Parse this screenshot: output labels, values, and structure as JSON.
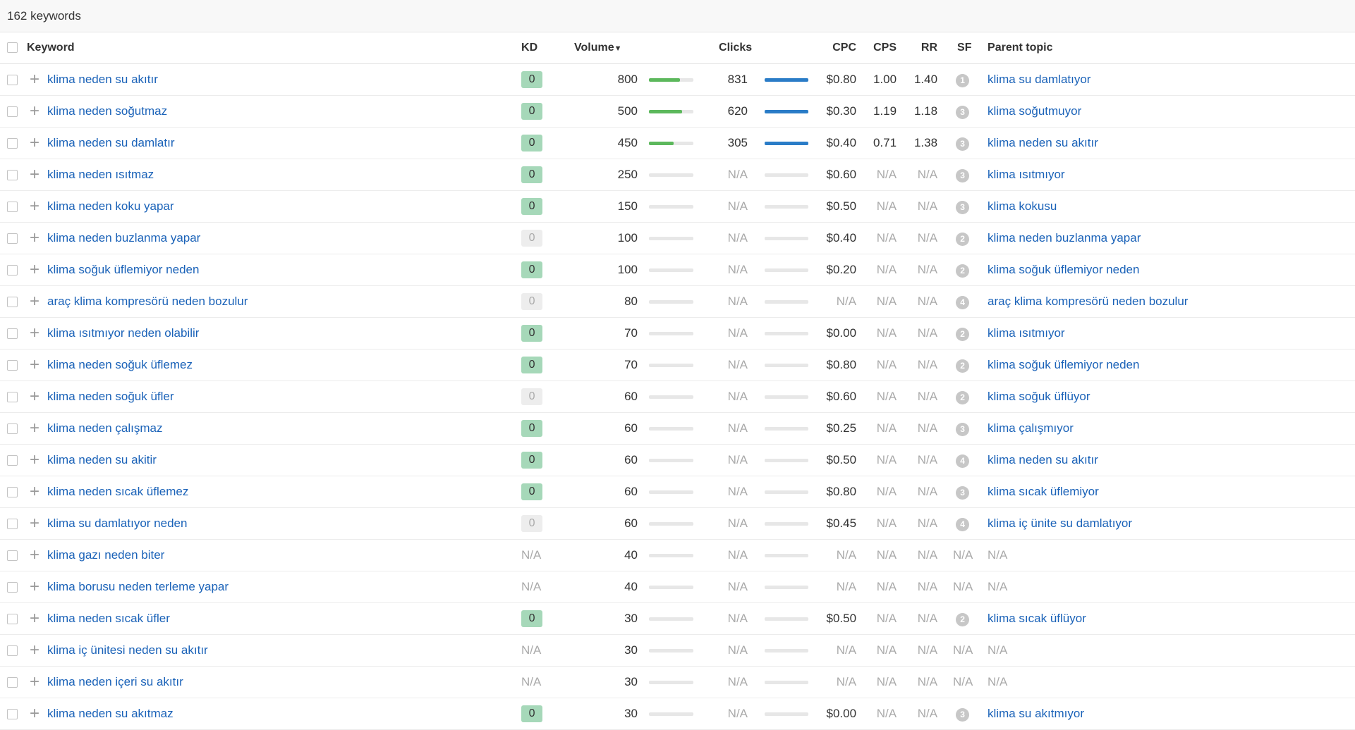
{
  "header": {
    "count_label": "162 keywords"
  },
  "columns": {
    "keyword": "Keyword",
    "kd": "KD",
    "volume": "Volume",
    "volume_sort": "▼",
    "clicks": "Clicks",
    "cpc": "CPC",
    "cps": "CPS",
    "rr": "RR",
    "sf": "SF",
    "parent_topic": "Parent topic"
  },
  "colors": {
    "link": "#1a62b8",
    "kd_green": "#a6d8b9",
    "volume_bar": "#5cb85c",
    "clicks_bar": "#2a7cc7"
  },
  "rows": [
    {
      "keyword": "klima neden su akıtır",
      "kd": "0",
      "kd_style": "green",
      "volume": "800",
      "volume_fill": 0.7,
      "clicks": "831",
      "clicks_fill": 1,
      "cpc": "$0.80",
      "cps": "1.00",
      "rr": "1.40",
      "sf": "1",
      "parent_topic": "klima su damlatıyor"
    },
    {
      "keyword": "klima neden soğutmaz",
      "kd": "0",
      "kd_style": "green",
      "volume": "500",
      "volume_fill": 0.75,
      "clicks": "620",
      "clicks_fill": 1,
      "cpc": "$0.30",
      "cps": "1.19",
      "rr": "1.18",
      "sf": "3",
      "parent_topic": "klima soğutmuyor"
    },
    {
      "keyword": "klima neden su damlatır",
      "kd": "0",
      "kd_style": "green",
      "volume": "450",
      "volume_fill": 0.55,
      "clicks": "305",
      "clicks_fill": 1,
      "cpc": "$0.40",
      "cps": "0.71",
      "rr": "1.38",
      "sf": "3",
      "parent_topic": "klima neden su akıtır"
    },
    {
      "keyword": "klima neden ısıtmaz",
      "kd": "0",
      "kd_style": "green",
      "volume": "250",
      "volume_fill": 0,
      "clicks": "N/A",
      "clicks_fill": 0,
      "cpc": "$0.60",
      "cps": "N/A",
      "rr": "N/A",
      "sf": "3",
      "parent_topic": "klima ısıtmıyor"
    },
    {
      "keyword": "klima neden koku yapar",
      "kd": "0",
      "kd_style": "green",
      "volume": "150",
      "volume_fill": 0,
      "clicks": "N/A",
      "clicks_fill": 0,
      "cpc": "$0.50",
      "cps": "N/A",
      "rr": "N/A",
      "sf": "3",
      "parent_topic": "klima kokusu"
    },
    {
      "keyword": "klima neden buzlanma yapar",
      "kd": "0",
      "kd_style": "grey",
      "volume": "100",
      "volume_fill": 0,
      "clicks": "N/A",
      "clicks_fill": 0,
      "cpc": "$0.40",
      "cps": "N/A",
      "rr": "N/A",
      "sf": "2",
      "parent_topic": "klima neden buzlanma yapar"
    },
    {
      "keyword": "klima soğuk üflemiyor neden",
      "kd": "0",
      "kd_style": "green",
      "volume": "100",
      "volume_fill": 0,
      "clicks": "N/A",
      "clicks_fill": 0,
      "cpc": "$0.20",
      "cps": "N/A",
      "rr": "N/A",
      "sf": "2",
      "parent_topic": "klima soğuk üflemiyor neden"
    },
    {
      "keyword": "araç klima kompresörü neden bozulur",
      "kd": "0",
      "kd_style": "grey",
      "volume": "80",
      "volume_fill": 0,
      "clicks": "N/A",
      "clicks_fill": 0,
      "cpc": "N/A",
      "cps": "N/A",
      "rr": "N/A",
      "sf": "4",
      "parent_topic": "araç klima kompresörü neden bozulur"
    },
    {
      "keyword": "klima ısıtmıyor neden olabilir",
      "kd": "0",
      "kd_style": "green",
      "volume": "70",
      "volume_fill": 0,
      "clicks": "N/A",
      "clicks_fill": 0,
      "cpc": "$0.00",
      "cps": "N/A",
      "rr": "N/A",
      "sf": "2",
      "parent_topic": "klima ısıtmıyor"
    },
    {
      "keyword": "klima neden soğuk üflemez",
      "kd": "0",
      "kd_style": "green",
      "volume": "70",
      "volume_fill": 0,
      "clicks": "N/A",
      "clicks_fill": 0,
      "cpc": "$0.80",
      "cps": "N/A",
      "rr": "N/A",
      "sf": "2",
      "parent_topic": "klima soğuk üflemiyor neden"
    },
    {
      "keyword": "klima neden soğuk üfler",
      "kd": "0",
      "kd_style": "grey",
      "volume": "60",
      "volume_fill": 0,
      "clicks": "N/A",
      "clicks_fill": 0,
      "cpc": "$0.60",
      "cps": "N/A",
      "rr": "N/A",
      "sf": "2",
      "parent_topic": "klima soğuk üflüyor"
    },
    {
      "keyword": "klima neden çalışmaz",
      "kd": "0",
      "kd_style": "green",
      "volume": "60",
      "volume_fill": 0,
      "clicks": "N/A",
      "clicks_fill": 0,
      "cpc": "$0.25",
      "cps": "N/A",
      "rr": "N/A",
      "sf": "3",
      "parent_topic": "klima çalışmıyor"
    },
    {
      "keyword": "klima neden su akitir",
      "kd": "0",
      "kd_style": "green",
      "volume": "60",
      "volume_fill": 0,
      "clicks": "N/A",
      "clicks_fill": 0,
      "cpc": "$0.50",
      "cps": "N/A",
      "rr": "N/A",
      "sf": "4",
      "parent_topic": "klima neden su akıtır"
    },
    {
      "keyword": "klima neden sıcak üflemez",
      "kd": "0",
      "kd_style": "green",
      "volume": "60",
      "volume_fill": 0,
      "clicks": "N/A",
      "clicks_fill": 0,
      "cpc": "$0.80",
      "cps": "N/A",
      "rr": "N/A",
      "sf": "3",
      "parent_topic": "klima sıcak üflemiyor"
    },
    {
      "keyword": "klima su damlatıyor neden",
      "kd": "0",
      "kd_style": "grey",
      "volume": "60",
      "volume_fill": 0,
      "clicks": "N/A",
      "clicks_fill": 0,
      "cpc": "$0.45",
      "cps": "N/A",
      "rr": "N/A",
      "sf": "4",
      "parent_topic": "klima iç ünite su damlatıyor"
    },
    {
      "keyword": "klima gazı neden biter",
      "kd": "N/A",
      "kd_style": "na",
      "volume": "40",
      "volume_fill": 0,
      "clicks": "N/A",
      "clicks_fill": 0,
      "cpc": "N/A",
      "cps": "N/A",
      "rr": "N/A",
      "sf": "N/A",
      "parent_topic": "N/A"
    },
    {
      "keyword": "klima borusu neden terleme yapar",
      "kd": "N/A",
      "kd_style": "na",
      "volume": "40",
      "volume_fill": 0,
      "clicks": "N/A",
      "clicks_fill": 0,
      "cpc": "N/A",
      "cps": "N/A",
      "rr": "N/A",
      "sf": "N/A",
      "parent_topic": "N/A"
    },
    {
      "keyword": "klima neden sıcak üfler",
      "kd": "0",
      "kd_style": "green",
      "volume": "30",
      "volume_fill": 0,
      "clicks": "N/A",
      "clicks_fill": 0,
      "cpc": "$0.50",
      "cps": "N/A",
      "rr": "N/A",
      "sf": "2",
      "parent_topic": "klima sıcak üflüyor"
    },
    {
      "keyword": "klima iç ünitesi neden su akıtır",
      "kd": "N/A",
      "kd_style": "na",
      "volume": "30",
      "volume_fill": 0,
      "clicks": "N/A",
      "clicks_fill": 0,
      "cpc": "N/A",
      "cps": "N/A",
      "rr": "N/A",
      "sf": "N/A",
      "parent_topic": "N/A"
    },
    {
      "keyword": "klima neden içeri su akıtır",
      "kd": "N/A",
      "kd_style": "na",
      "volume": "30",
      "volume_fill": 0,
      "clicks": "N/A",
      "clicks_fill": 0,
      "cpc": "N/A",
      "cps": "N/A",
      "rr": "N/A",
      "sf": "N/A",
      "parent_topic": "N/A"
    },
    {
      "keyword": "klima neden su akıtmaz",
      "kd": "0",
      "kd_style": "green",
      "volume": "30",
      "volume_fill": 0,
      "clicks": "N/A",
      "clicks_fill": 0,
      "cpc": "$0.00",
      "cps": "N/A",
      "rr": "N/A",
      "sf": "3",
      "parent_topic": "klima su akıtmıyor"
    }
  ]
}
